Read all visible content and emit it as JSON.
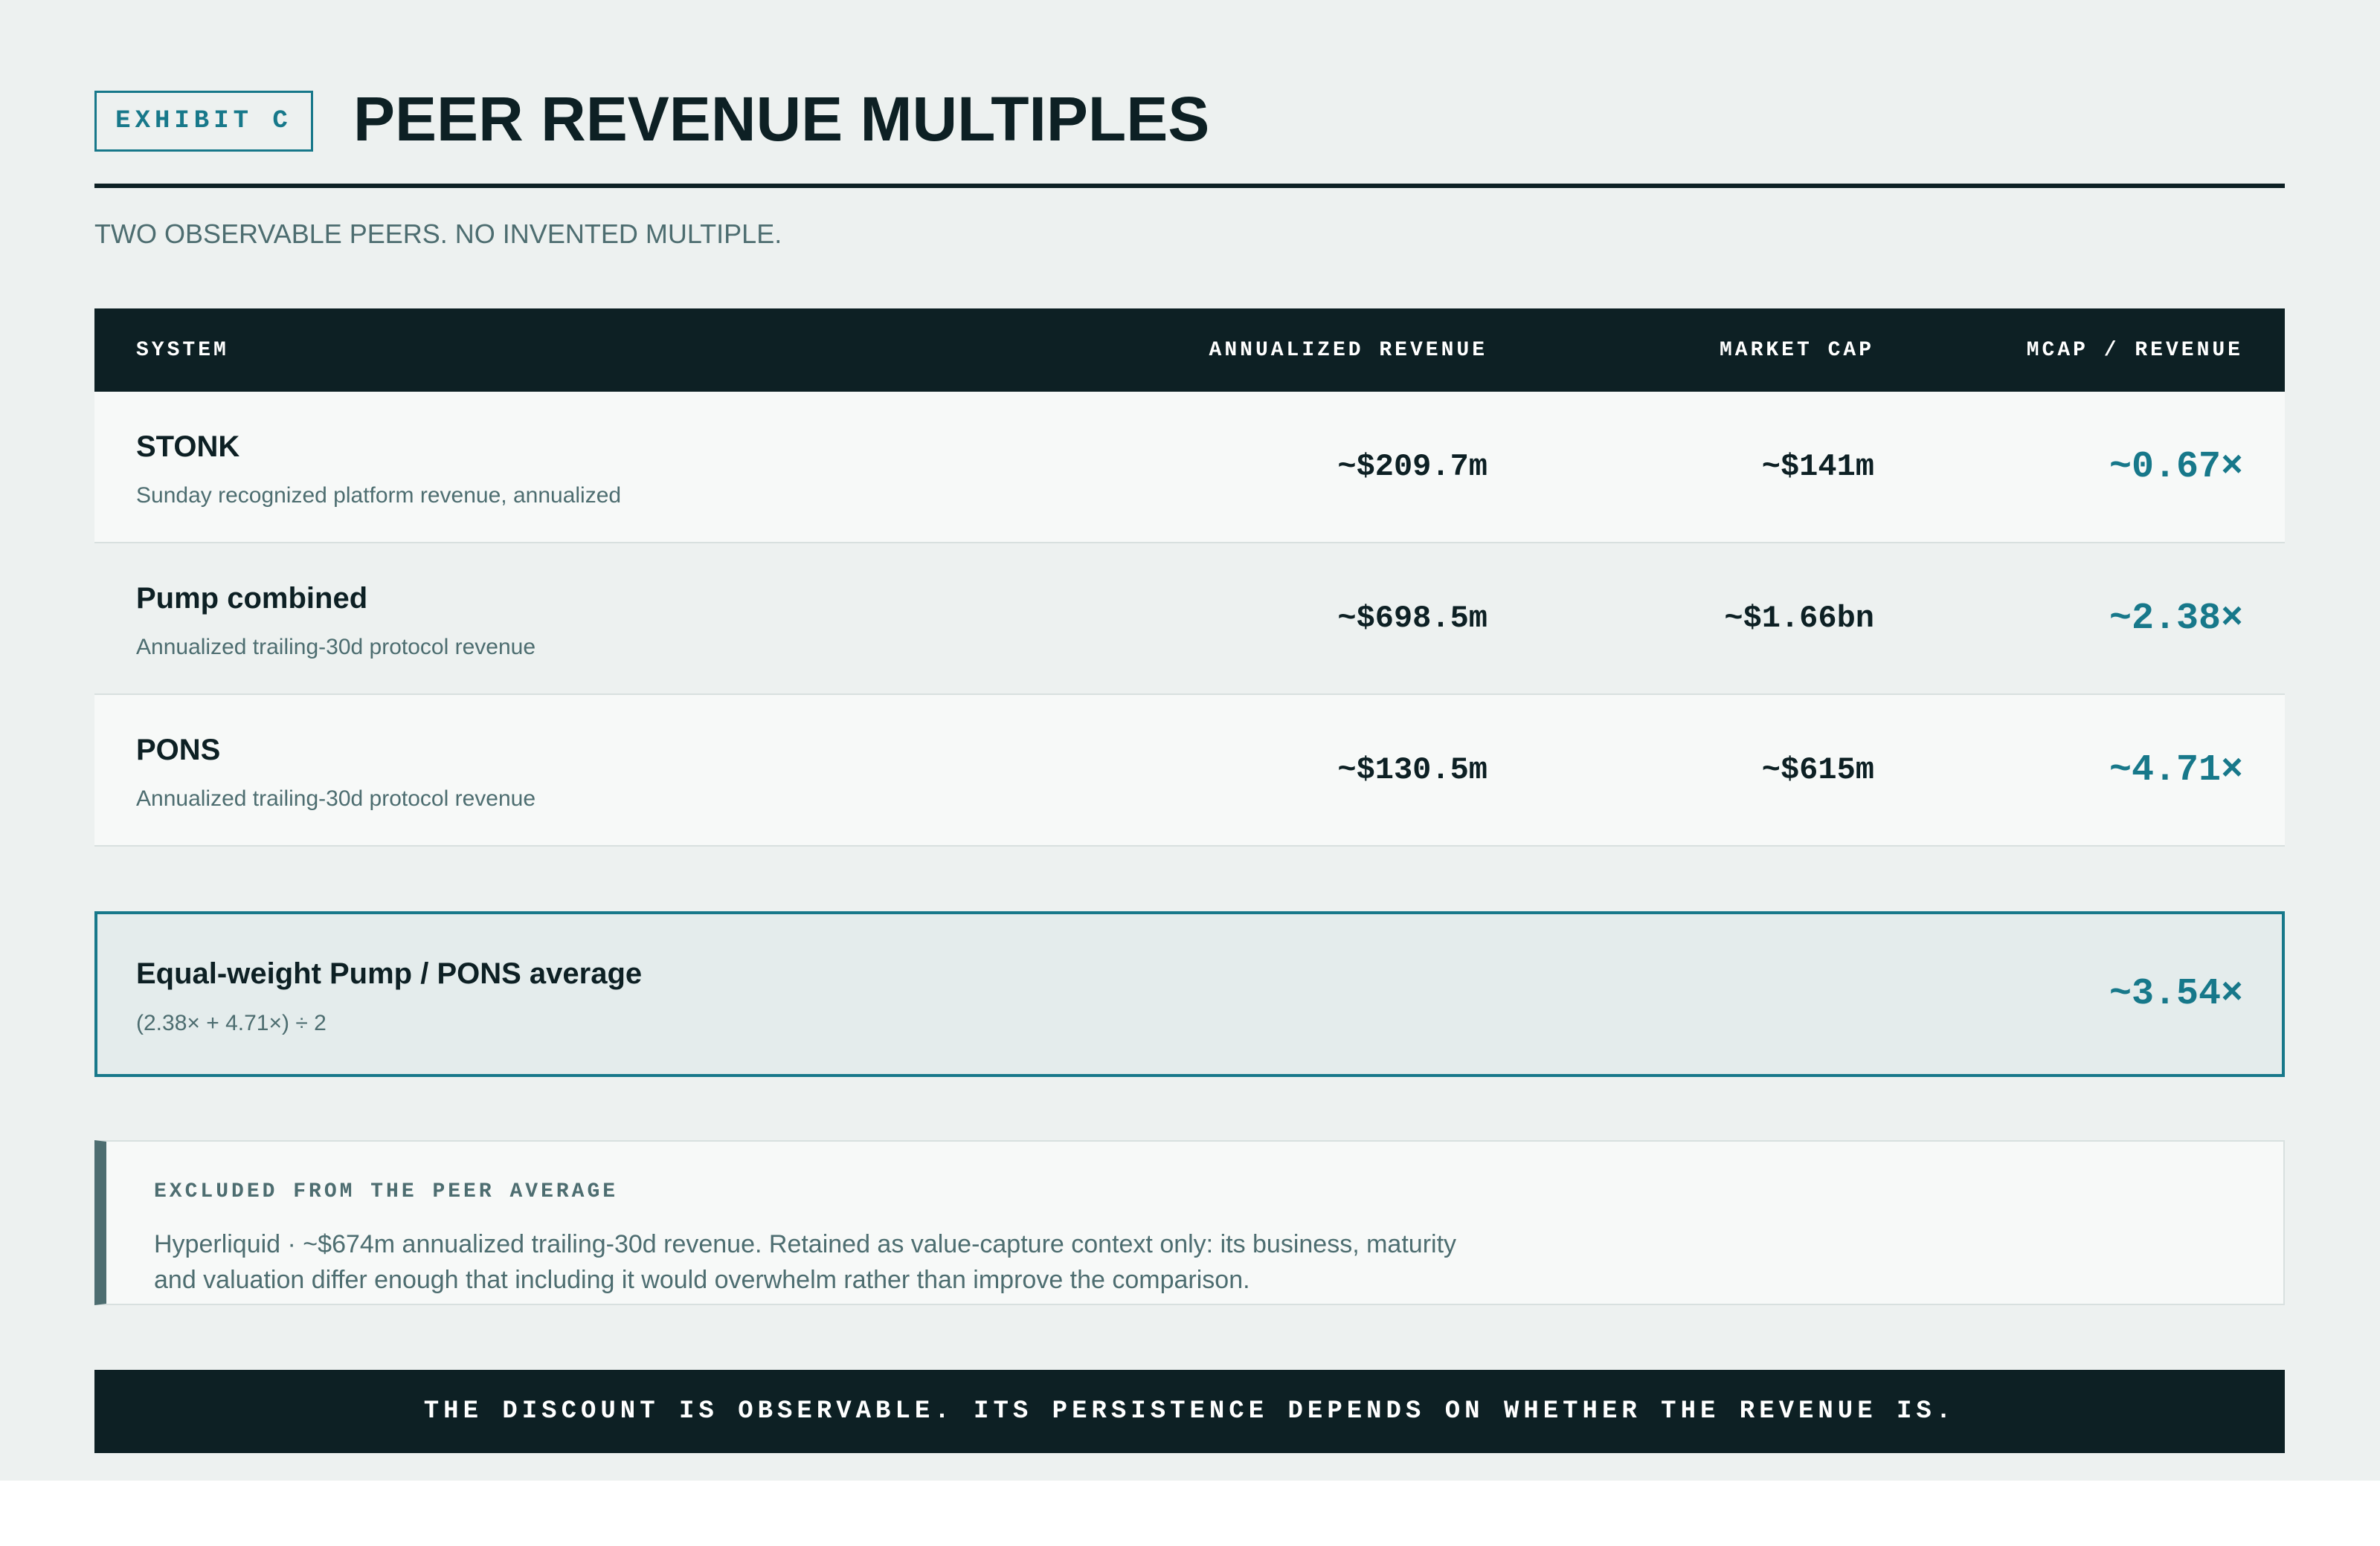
{
  "header": {
    "exhibit_label": "EXHIBIT C",
    "title": "PEER REVENUE MULTIPLES",
    "subtitle": "TWO OBSERVABLE PEERS. NO INVENTED MULTIPLE."
  },
  "table": {
    "columns": [
      "SYSTEM",
      "ANNUALIZED REVENUE",
      "MARKET CAP",
      "MCAP / REVENUE"
    ],
    "rows": [
      {
        "name": "STONK",
        "description": "Sunday recognized platform revenue, annualized",
        "annualized_revenue": "~$209.7m",
        "market_cap": "~$141m",
        "multiple": "~0.67×"
      },
      {
        "name": "Pump combined",
        "description": "Annualized trailing-30d protocol revenue",
        "annualized_revenue": "~$698.5m",
        "market_cap": "~$1.66bn",
        "multiple": "~2.38×"
      },
      {
        "name": "PONS",
        "description": "Annualized trailing-30d protocol revenue",
        "annualized_revenue": "~$130.5m",
        "market_cap": "~$615m",
        "multiple": "~4.71×"
      }
    ]
  },
  "average": {
    "label": "Equal-weight Pump / PONS average",
    "formula": "(2.38× + 4.71×) ÷ 2",
    "multiple": "~3.54×"
  },
  "excluded": {
    "label": "EXCLUDED FROM THE PEER AVERAGE",
    "body": "Hyperliquid · ~$674m annualized trailing-30d revenue. Retained as value-capture context only: its business, maturity and valuation differ enough that including it would overwhelm rather than improve the comparison."
  },
  "footer": {
    "banner": "THE DISCOUNT IS OBSERVABLE. ITS PERSISTENCE DEPENDS ON WHETHER THE REVENUE IS."
  },
  "colors": {
    "ink": "#0d2024",
    "accent": "#17788a",
    "muted": "#4d6d70",
    "background": "#edf1f0"
  }
}
